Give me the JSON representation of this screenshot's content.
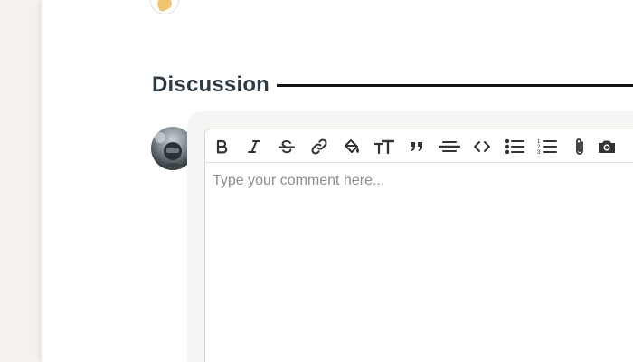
{
  "discussion": {
    "title": "Discussion"
  },
  "editor": {
    "placeholder": "Type your comment here...",
    "toolbar": [
      {
        "id": "bold",
        "icon": "bold-icon"
      },
      {
        "id": "italic",
        "icon": "italic-icon"
      },
      {
        "id": "strikethrough",
        "icon": "strikethrough-icon"
      },
      {
        "id": "link",
        "icon": "link-icon"
      },
      {
        "id": "highlight",
        "icon": "paint-bucket-icon"
      },
      {
        "id": "heading",
        "icon": "text-size-icon"
      },
      {
        "id": "quote",
        "icon": "quote-icon"
      },
      {
        "id": "divider",
        "icon": "horizontal-rule-icon"
      },
      {
        "id": "code",
        "icon": "code-icon"
      },
      {
        "id": "bullet-list",
        "icon": "bullet-list-icon"
      },
      {
        "id": "numbered-list",
        "icon": "numbered-list-icon"
      },
      {
        "id": "attach",
        "icon": "paperclip-icon"
      },
      {
        "id": "image",
        "icon": "camera-icon"
      }
    ]
  },
  "colors": {
    "title": "#2f3b45",
    "rule": "#111111",
    "icon": "#333333",
    "placeholder": "#8e8e8e",
    "background": "#f4f1ee"
  }
}
